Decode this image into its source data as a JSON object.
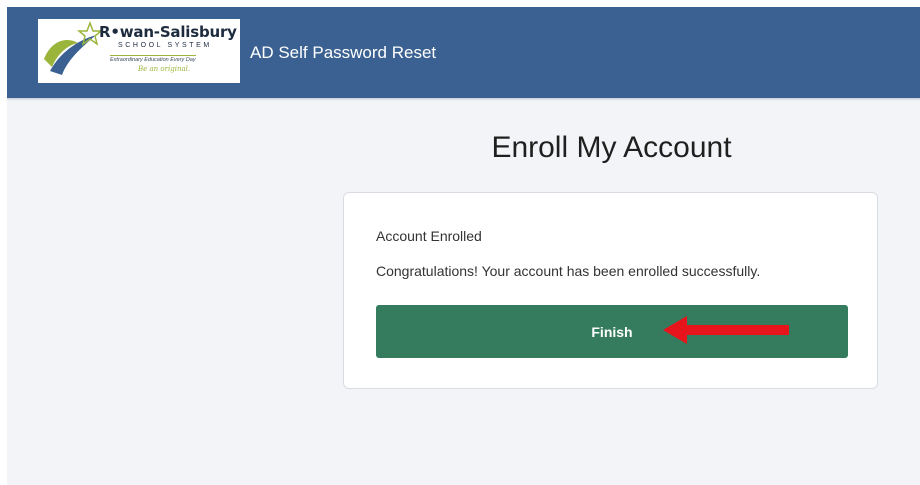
{
  "header": {
    "logo": {
      "title": "R•wan-Salisbury",
      "subtitle": "SCHOOL SYSTEM",
      "tagline": "Extraordinary Education Every Day",
      "motto": "Be an original."
    },
    "app_title": "AD Self Password Reset",
    "background_color": "#3a6191"
  },
  "main": {
    "page_title": "Enroll My Account",
    "card": {
      "status": "Account Enrolled",
      "message": "Congratulations! Your account has been enrolled successfully.",
      "finish_label": "Finish",
      "button_color": "#357c5e"
    },
    "annotation": {
      "icon": "red-arrow-icon",
      "color": "#e8141b"
    }
  }
}
